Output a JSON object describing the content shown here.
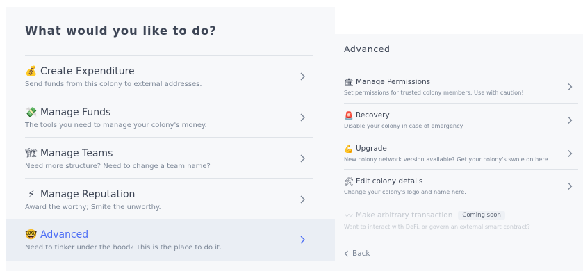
{
  "left_dialog": {
    "title": "What would you like to do?",
    "items": [
      {
        "emoji": "💰",
        "title": "Create Expenditure",
        "description": "Send funds from this colony to external addresses."
      },
      {
        "emoji": "💸",
        "title": "Manage Funds",
        "description": "The tools you need to manage your colony's money."
      },
      {
        "emoji": "🏗",
        "title": "Manage Teams",
        "description": "Need more structure? Need to change a team name?"
      },
      {
        "emoji": "⚡",
        "title": "Manage Reputation",
        "description": "Award the worthy; Smite the unworthy."
      },
      {
        "emoji": "🤓",
        "title": "Advanced",
        "description": "Need to tinker under the hood? This is the place to do it."
      }
    ]
  },
  "right_dialog": {
    "title": "Advanced",
    "items": [
      {
        "emoji": "🏛",
        "title": "Manage Permissions",
        "description": "Set permissions for trusted colony members. Use with caution!"
      },
      {
        "emoji": "🚨",
        "title": "Recovery",
        "description": "Disable your colony in case of emergency."
      },
      {
        "emoji": "💪",
        "title": "Upgrade",
        "description": "New colony network version available? Get your colony's swole on here."
      },
      {
        "emoji": "🛠",
        "title": "Edit colony details",
        "description": "Change your colony's logo and name here."
      },
      {
        "emoji": "〰",
        "title": "Make arbitrary transaction",
        "badge": "Coming soon",
        "description": "Want to interact with DeFi, or govern an external smart contract?"
      }
    ],
    "back_label": "Back"
  },
  "colors": {
    "accent": "#4d6ef5",
    "text": "#3d4555",
    "muted": "#7a8595",
    "panel": "#f7f8fa",
    "selected_row": "#eaeef4"
  },
  "icons": {
    "chevron": "chevron-right-icon",
    "back": "chevron-left-icon"
  }
}
